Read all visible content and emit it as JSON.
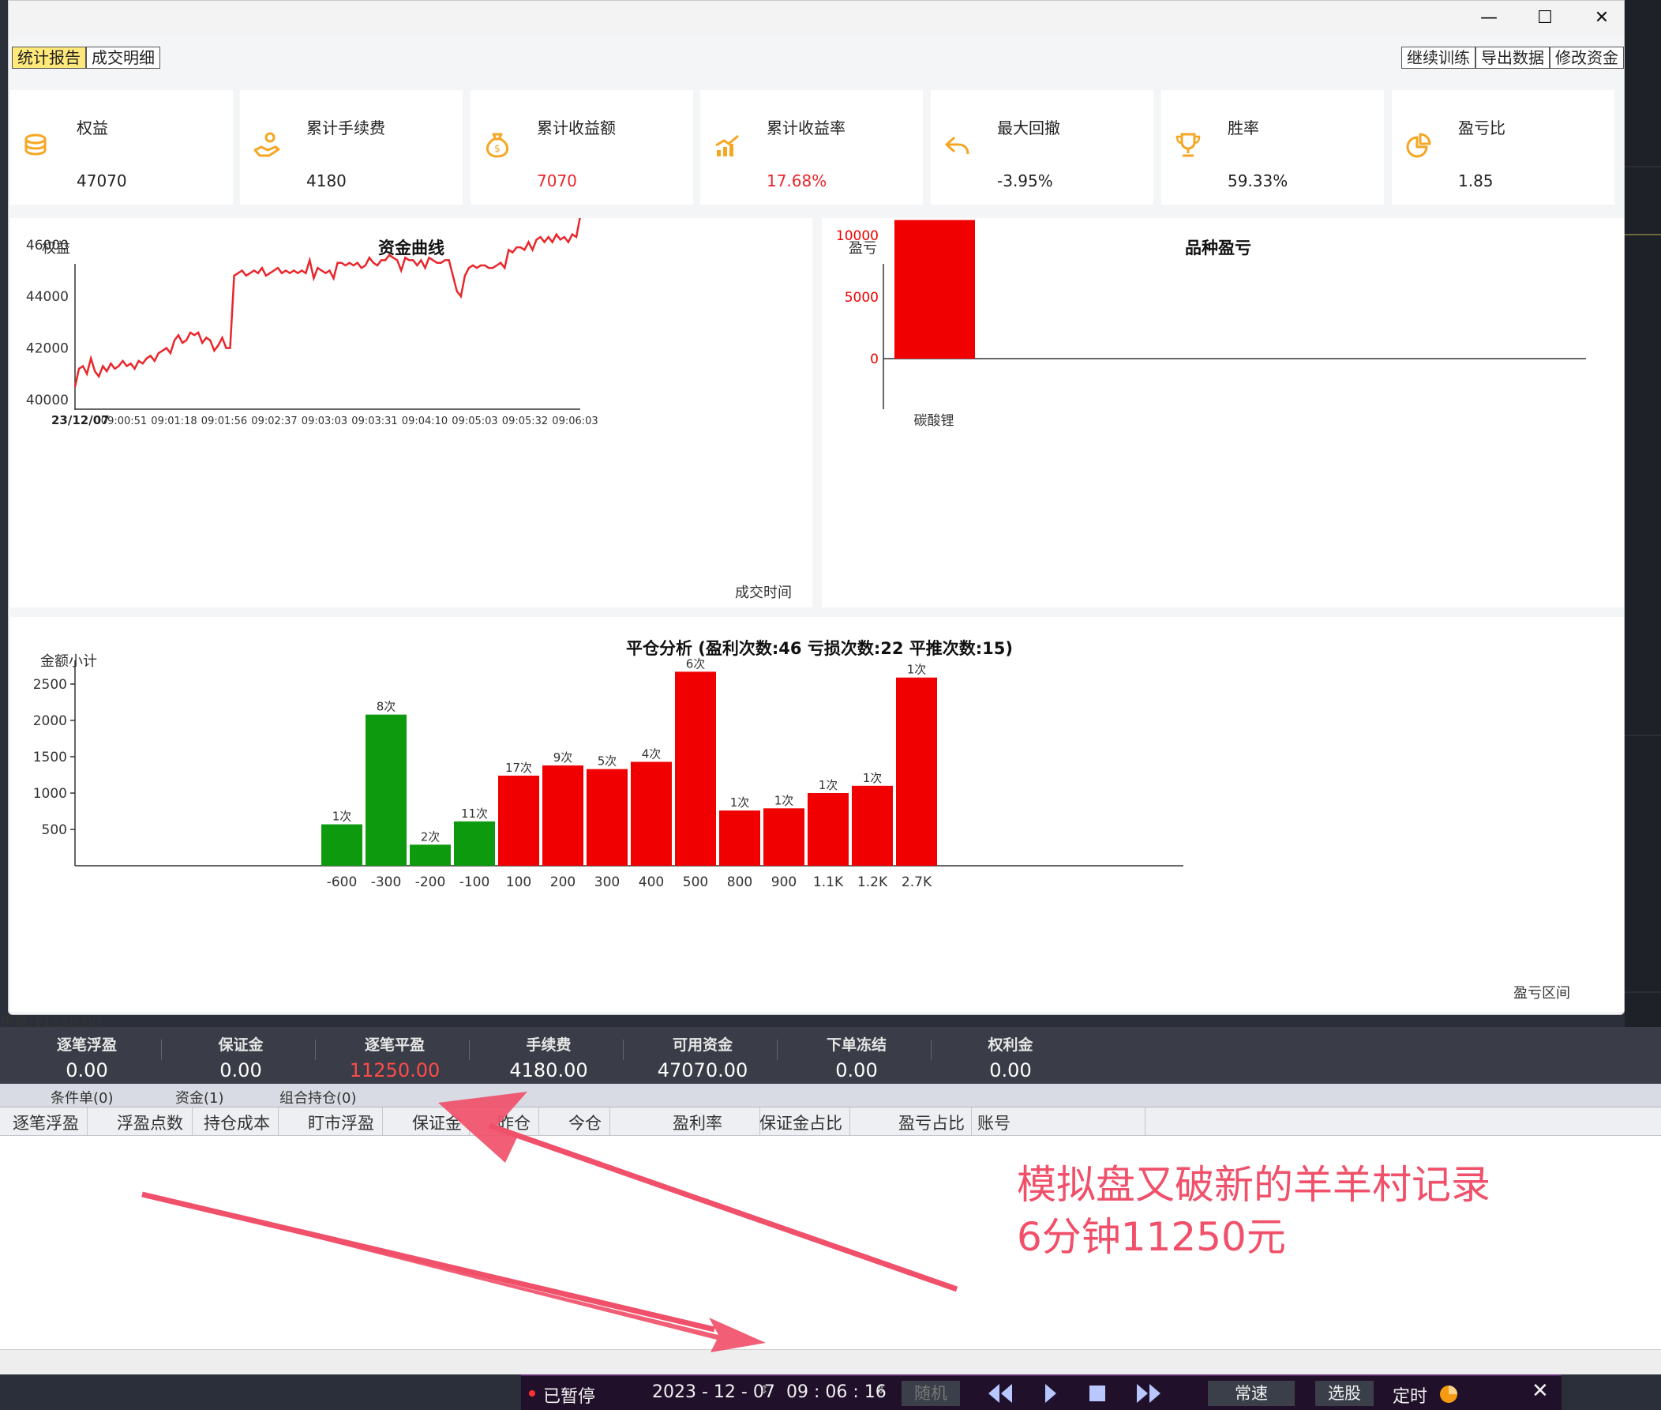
{
  "titlebar": {
    "minimize": "—",
    "maximize": "☐",
    "close": "✕"
  },
  "tabs": [
    {
      "label": "统计报告"
    },
    {
      "label": "成交明细"
    }
  ],
  "actions": [
    {
      "label": "继续训练"
    },
    {
      "label": "导出数据"
    },
    {
      "label": "修改资金"
    }
  ],
  "stats": [
    {
      "label": "权益",
      "value": "47070",
      "icon": "coins-icon"
    },
    {
      "label": "累计手续费",
      "value": "4180",
      "icon": "hand-coins-icon"
    },
    {
      "label": "累计收益额",
      "value": "7070",
      "icon": "money-bag-icon",
      "highlight": true
    },
    {
      "label": "累计收益率",
      "value": "17.68%",
      "icon": "bar-growth-icon",
      "highlight": true
    },
    {
      "label": "最大回撤",
      "value": "-3.95%",
      "icon": "undo-arrow-icon"
    },
    {
      "label": "胜率",
      "value": "59.33%",
      "icon": "trophy-icon"
    },
    {
      "label": "盈亏比",
      "value": "1.85",
      "icon": "pie-icon"
    }
  ],
  "colors": {
    "accent_orange": "#f5a623",
    "loss_red": "#f00000",
    "gain_green": "#0e9a0e",
    "curve_red": "#e8262b",
    "annotation": "#f0506a"
  },
  "chart_data": [
    {
      "type": "line",
      "title": "资金曲线",
      "ylabel": "权益",
      "xlabel": "成交时间",
      "x_start_label": "23/12/07",
      "xticks": [
        "09:00:51",
        "09:01:18",
        "09:01:56",
        "09:02:37",
        "09:03:03",
        "09:03:31",
        "09:04:10",
        "09:05:03",
        "09:05:32",
        "09:06:03"
      ],
      "yticks": [
        40000,
        42000,
        44000,
        46000
      ],
      "ylim": [
        40000,
        47000
      ],
      "series": [
        {
          "values": [
            40500,
            41200,
            41300,
            41000,
            41600,
            41100,
            40900,
            41300,
            41100,
            41400,
            41200,
            41300,
            41500,
            41300,
            41400,
            41200,
            41500,
            41400,
            41600,
            41700,
            41500,
            41800,
            41900,
            42000,
            41800,
            42300,
            42500,
            42200,
            42300,
            42600,
            42500,
            42600,
            42200,
            42400,
            42300,
            41900,
            42100,
            42400,
            42000,
            42000,
            44800,
            44900,
            45000,
            44800,
            44900,
            45000,
            44900,
            45100,
            44800,
            44900,
            45000,
            45100,
            44900,
            45000,
            44900,
            45000,
            44900,
            45000,
            44900,
            45400,
            44700,
            45100,
            45000,
            44900,
            45000,
            44700,
            45300,
            45300,
            45200,
            45300,
            45200,
            45300,
            45100,
            45200,
            45500,
            45300,
            45200,
            45400,
            45400,
            45600,
            45500,
            45400,
            45000,
            45500,
            45400,
            45400,
            45200,
            45400,
            45100,
            45500,
            45400,
            45300,
            45300,
            45400,
            45400,
            44800,
            44200,
            44000,
            44800,
            45100,
            45200,
            45100,
            45200,
            45200,
            45100,
            45100,
            45200,
            45300,
            45100,
            45800,
            45700,
            45900,
            45900,
            45800,
            46100,
            45800,
            46200,
            46300,
            46100,
            46300,
            46100,
            46400,
            46200,
            46300,
            46100,
            46400,
            46300,
            47100
          ]
        }
      ]
    },
    {
      "type": "bar",
      "title": "品种盈亏",
      "ylabel": "盈亏",
      "categories": [
        "碳酸锂"
      ],
      "values": [
        11250
      ],
      "yticks": [
        0,
        5000,
        10000
      ],
      "ylim": [
        -4000,
        12500
      ]
    },
    {
      "type": "bar",
      "title": "平仓分析 (盈利次数:46 亏损次数:22 平推次数:15)",
      "ylabel": "金额小计",
      "xlabel": "盈亏区间",
      "categories": [
        "-600",
        "-300",
        "-200",
        "-100",
        "100",
        "200",
        "300",
        "400",
        "500",
        "800",
        "900",
        "1.1K",
        "1.2K",
        "2.7K"
      ],
      "values": [
        570,
        2080,
        290,
        610,
        1240,
        1380,
        1330,
        1430,
        2670,
        760,
        790,
        1000,
        1100,
        2590
      ],
      "counts": [
        "1次",
        "8次",
        "2次",
        "11次",
        "17次",
        "9次",
        "5次",
        "4次",
        "6次",
        "1次",
        "1次",
        "1次",
        "1次",
        "1次"
      ],
      "yticks": [
        500,
        1000,
        1500,
        2000,
        2500
      ],
      "ylim": [
        0,
        2800
      ]
    }
  ],
  "status_line": "平盈:11250.00",
  "account": [
    {
      "label": "逐笔浮盈",
      "value": "0.00"
    },
    {
      "label": "保证金",
      "value": "0.00"
    },
    {
      "label": "逐笔平盈",
      "value": "11250.00",
      "highlight": true
    },
    {
      "label": "手续费",
      "value": "4180.00"
    },
    {
      "label": "可用资金",
      "value": "47070.00"
    },
    {
      "label": "下单冻结",
      "value": "0.00"
    },
    {
      "label": "权利金",
      "value": "0.00"
    }
  ],
  "subtabs": [
    "条件单(0)",
    "资金(1)",
    "组合持仓(0)"
  ],
  "columns": [
    "逐笔浮盈",
    "浮盈点数",
    "持仓成本",
    "盯市浮盈",
    "保证金",
    "昨仓",
    "今仓",
    "盈利率",
    "保证金占比",
    "盈亏占比",
    "账号"
  ],
  "player": {
    "status": "已暂停",
    "date": "2023 - 12 - 07",
    "time": "09 : 06 : 16",
    "random": "随机",
    "speed": "常速",
    "pick": "选股",
    "timer": "定时"
  },
  "annotation": {
    "line1": "模拟盘又破新的羊羊村记录",
    "line2": "6分钟11250元"
  }
}
